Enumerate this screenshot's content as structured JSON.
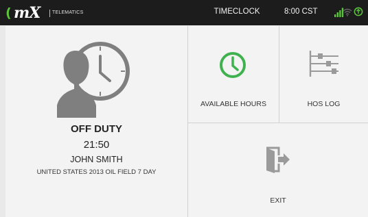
{
  "topbar": {
    "logo_text": "mX",
    "logo_tag": "TELEMATICS",
    "title": "TIMECLOCK",
    "clock": "8:00 CST",
    "icons": [
      "signal-icon",
      "wifi-icon",
      "gps-icon"
    ],
    "colors": {
      "background": "#1c1c1c",
      "accent": "#5cc43b",
      "muted": "#777777"
    }
  },
  "driver_status": {
    "duty_status": "OFF DUTY",
    "time": "21:50",
    "driver_name": "JOHN SMITH",
    "ruleset": "UNITED STATES 2013 OIL FIELD 7 DAY",
    "icon": "driver-clock-icon"
  },
  "tiles": [
    {
      "label": "AVAILABLE HOURS",
      "icon": "clock-icon",
      "color": "#3fb24f"
    },
    {
      "label": "HOS LOG",
      "icon": "log-sliders-icon",
      "color": "#9a9a9a"
    },
    {
      "label": "EXIT",
      "icon": "exit-door-icon",
      "color": "#9a9a9a"
    }
  ]
}
